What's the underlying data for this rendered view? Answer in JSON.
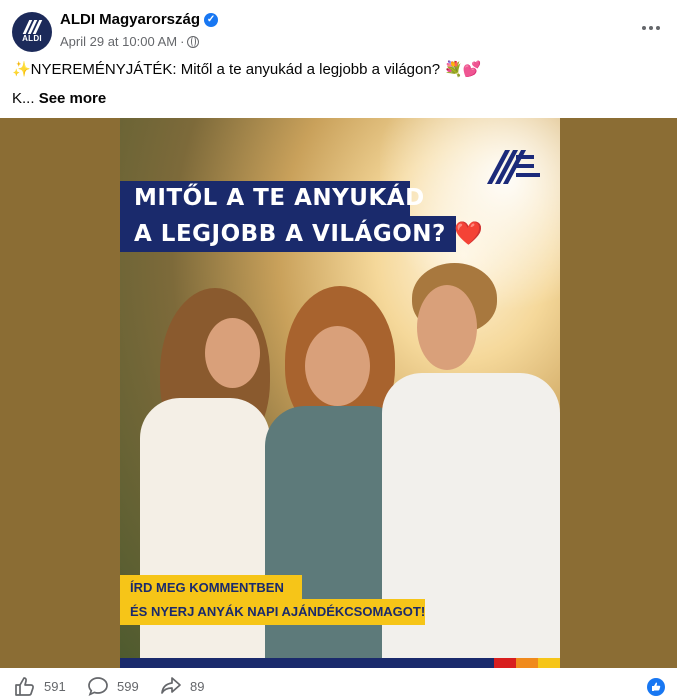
{
  "post": {
    "page_name": "ALDI Magyarország",
    "avatar_label": "ALDI",
    "timestamp": "April 29 at 10:00 AM",
    "separator": "·",
    "caption_line1": "✨NYEREMÉNYJÁTÉK: Mitől a te anyukád a legjobb a világon? 💐💕",
    "caption_line2_prefix": "K...",
    "see_more": "See more"
  },
  "image": {
    "headline_line1": "MITŐL A TE ANYUKÁD",
    "headline_line2": "A LEGJOBB A VILÁGON?",
    "headline_heart": "❤️",
    "cta_line1": "ÍRD MEG KOMMENTBEN",
    "cta_line2": "ÉS NYERJ ANYÁK NAPI AJÁNDÉKCSOMAGOT!"
  },
  "stats": {
    "reactions": "591",
    "comments": "599",
    "shares": "89"
  },
  "colors": {
    "aldi_navy": "#1a2a6c",
    "aldi_yellow": "#f6c518",
    "facebook_blue": "#1877f2",
    "media_background": "#8b6d34"
  },
  "icons": [
    "verified-icon",
    "globe-icon",
    "more-options-icon",
    "like-icon",
    "comment-icon",
    "share-icon",
    "like-reaction-icon"
  ]
}
